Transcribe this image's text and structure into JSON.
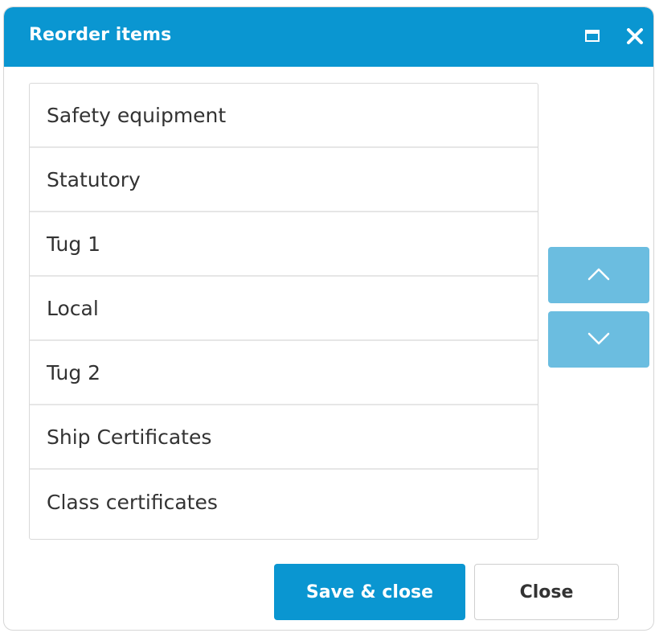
{
  "dialog": {
    "title": "Reorder items",
    "maximize_icon": "maximize-icon",
    "close_icon": "close-icon"
  },
  "list": {
    "items": [
      {
        "label": "Safety equipment"
      },
      {
        "label": "Statutory"
      },
      {
        "label": "Tug 1"
      },
      {
        "label": "Local"
      },
      {
        "label": "Tug 2"
      },
      {
        "label": "Ship Certificates"
      },
      {
        "label": "Class certificates"
      }
    ]
  },
  "controls": {
    "move_up_icon": "chevron-up-icon",
    "move_down_icon": "chevron-down-icon"
  },
  "footer": {
    "save_label": "Save & close",
    "close_label": "Close"
  },
  "colors": {
    "accent": "#0a96d1",
    "move_button": "#6bbde0"
  }
}
